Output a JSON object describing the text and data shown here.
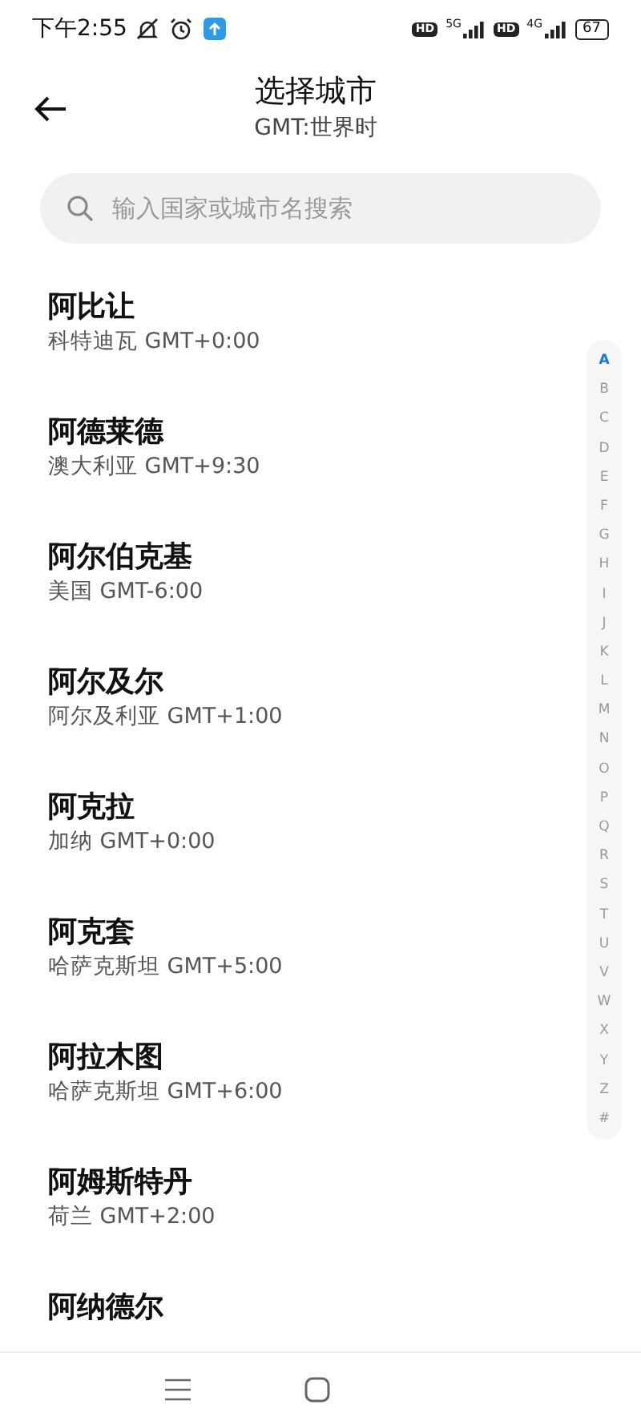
{
  "status_bar": {
    "time": "下午2:55",
    "right": [
      {
        "kind": "hd",
        "text": "HD"
      },
      {
        "kind": "signal",
        "text": "5G"
      },
      {
        "kind": "hd",
        "text": "HD"
      },
      {
        "kind": "signal",
        "text": "4G"
      },
      {
        "kind": "battery",
        "text": "67"
      }
    ]
  },
  "header": {
    "title": "选择城市",
    "subtitle": "GMT:世界时"
  },
  "search": {
    "placeholder": "输入国家或城市名搜索"
  },
  "cities": [
    {
      "name": "阿比让",
      "detail": "科特迪瓦 GMT+0:00"
    },
    {
      "name": "阿德莱德",
      "detail": "澳大利亚 GMT+9:30"
    },
    {
      "name": "阿尔伯克基",
      "detail": "美国 GMT-6:00"
    },
    {
      "name": "阿尔及尔",
      "detail": "阿尔及利亚 GMT+1:00"
    },
    {
      "name": "阿克拉",
      "detail": "加纳 GMT+0:00"
    },
    {
      "name": "阿克套",
      "detail": "哈萨克斯坦 GMT+5:00"
    },
    {
      "name": "阿拉木图",
      "detail": "哈萨克斯坦 GMT+6:00"
    },
    {
      "name": "阿姆斯特丹",
      "detail": "荷兰 GMT+2:00"
    },
    {
      "name": "阿纳德尔"
    }
  ],
  "index": [
    {
      "letter": "A",
      "selected": true
    },
    {
      "letter": "B",
      "selected": false
    },
    {
      "letter": "C",
      "selected": false
    },
    {
      "letter": "D",
      "selected": false
    },
    {
      "letter": "E",
      "selected": false
    },
    {
      "letter": "F",
      "selected": false
    },
    {
      "letter": "G",
      "selected": false
    },
    {
      "letter": "H",
      "selected": false
    },
    {
      "letter": "I",
      "selected": false
    },
    {
      "letter": "J",
      "selected": false
    },
    {
      "letter": "K",
      "selected": false
    },
    {
      "letter": "L",
      "selected": false
    },
    {
      "letter": "M",
      "selected": false
    },
    {
      "letter": "N",
      "selected": false
    },
    {
      "letter": "O",
      "selected": false
    },
    {
      "letter": "P",
      "selected": false
    },
    {
      "letter": "Q",
      "selected": false
    },
    {
      "letter": "R",
      "selected": false
    },
    {
      "letter": "S",
      "selected": false
    },
    {
      "letter": "T",
      "selected": false
    },
    {
      "letter": "U",
      "selected": false
    },
    {
      "letter": "V",
      "selected": false
    },
    {
      "letter": "W",
      "selected": false
    },
    {
      "letter": "X",
      "selected": false
    },
    {
      "letter": "Y",
      "selected": false
    },
    {
      "letter": "Z",
      "selected": false
    },
    {
      "letter": "#",
      "selected": false
    }
  ]
}
